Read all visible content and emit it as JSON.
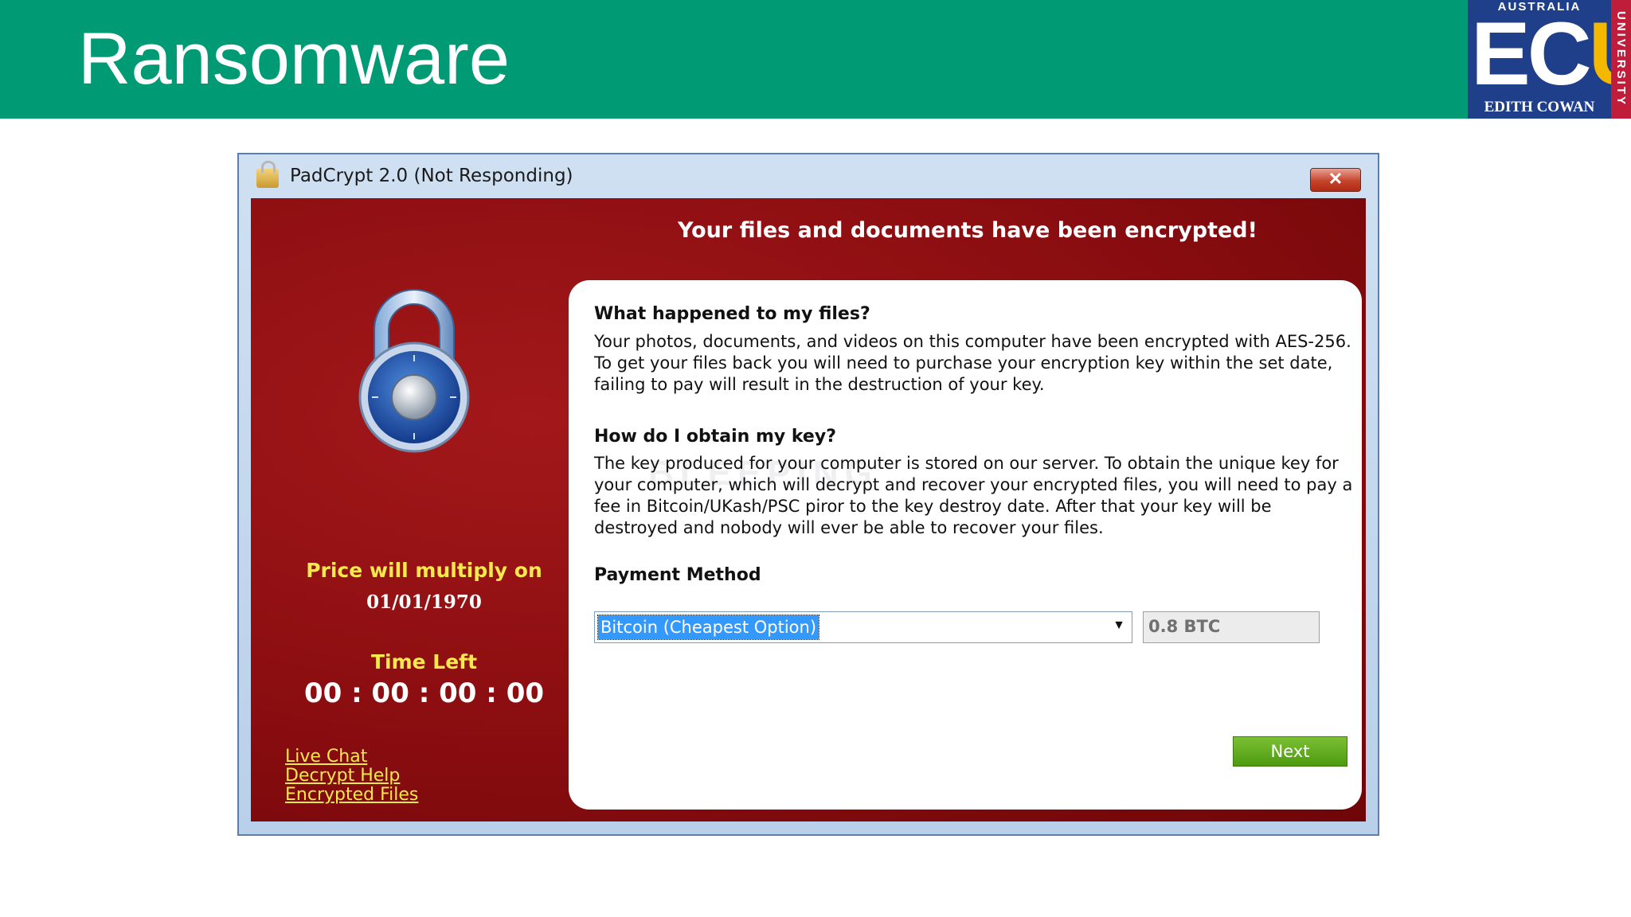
{
  "slide": {
    "title": "Ransomware",
    "logo": {
      "top_text": "AUSTRALIA",
      "main_text_a": "EC",
      "main_text_b": "U",
      "bottom_text": "EDITH COWAN",
      "side_text": "UNIVERSITY"
    }
  },
  "window": {
    "title": "PadCrypt 2.0 (Not Responding)",
    "close_label": "✕",
    "headline": "Your files and documents have been encrypted!",
    "lock_icon": "padlock-icon",
    "price_label": "Price will multiply on",
    "price_date": "01/01/1970",
    "time_left_label": "Time Left",
    "timer": "00 : 00 : 00 : 00",
    "links": [
      "Live Chat",
      "Decrypt Help",
      "Encrypted Files"
    ],
    "panel": {
      "q1": "What happened to my files?",
      "a1": "Your photos, documents, and videos on this computer have been encrypted with AES-256. To get your files back you will need to purchase your encryption key within the set date, failing to pay will result in the destruction of your key.",
      "q2": "How do I obtain my key?",
      "a2": "The key produced for your computer is stored on our server. To obtain the unique key for your computer, which will decrypt and recover your encrypted files, you will need to pay a fee in Bitcoin/UKash/PSC piror to the key destroy date. After that your key will be destroyed and nobody will ever be able to recover your files.",
      "payment_heading": "Payment Method",
      "payment_selected": "Bitcoin (Cheapest Option)",
      "amount": "0.8 BTC",
      "next_label": "Next",
      "watermark": "BLEEPING"
    }
  },
  "colors": {
    "header_green": "#009a74",
    "ransom_red": "#8a0d10",
    "accent_yellow": "#f7e84e",
    "next_green": "#5ba81a"
  }
}
